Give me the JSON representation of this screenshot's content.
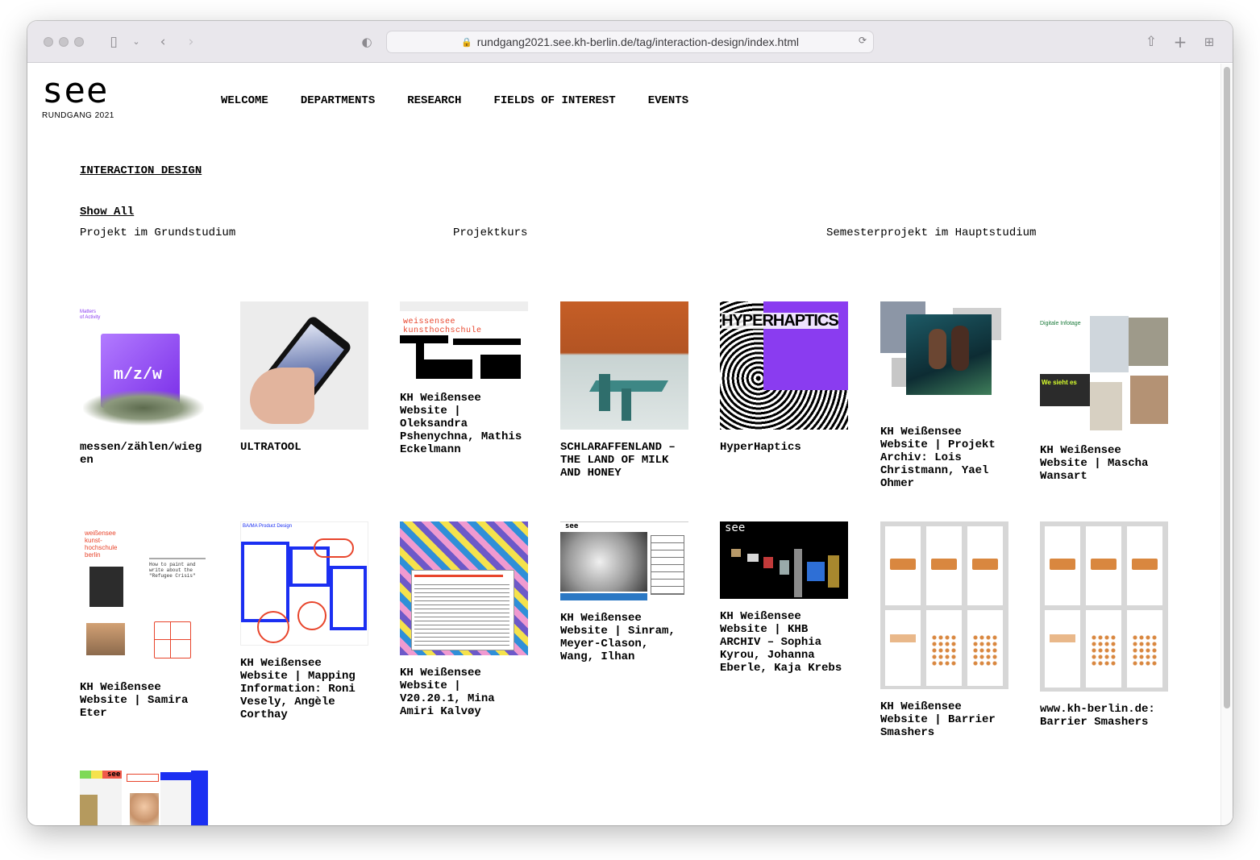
{
  "browser": {
    "url": "rundgang2021.see.kh-berlin.de/tag/interaction-design/index.html"
  },
  "site": {
    "logo": "see",
    "logo_sub": "RUNDGANG 2021"
  },
  "nav": [
    "WELCOME",
    "DEPARTMENTS",
    "RESEARCH",
    "FIELDS OF INTEREST",
    "EVENTS"
  ],
  "tag_title": "INTERACTION DESIGN",
  "filters": {
    "show_all": "Show All",
    "items": [
      "Projekt im Grundstudium",
      "Projektkurs",
      "Semesterprojekt im Hauptstudium"
    ]
  },
  "projects": [
    {
      "title": "messen/zählen/wiegen",
      "thumb_text": "m/z/w"
    },
    {
      "title": "ULTRATOOL",
      "thumb_text": ""
    },
    {
      "title": "KH Weißensee Website | Oleksandra Pshenychna, Mathis Eckelmann",
      "thumb_text": "weissensee kunsthochschule"
    },
    {
      "title": "SCHLARAFFENLAND – THE LAND OF MILK AND HONEY",
      "thumb_text": ""
    },
    {
      "title": "HyperHaptics",
      "thumb_text": "HYPERHAPTICS"
    },
    {
      "title": "KH Weißensee Website | Projekt Archiv: Lois Christmann, Yael Ohmer",
      "thumb_text": ""
    },
    {
      "title": "KH Weißensee Website | Mascha Wansart",
      "thumb_text": "Digitale Infotage"
    },
    {
      "title": "KH Weißensee Website | Samira Eter",
      "thumb_text": "weißensee kunst-hochschule berlin"
    },
    {
      "title": "KH Weißensee Website | Mapping Information: Roni Vesely, Angèle Corthay",
      "thumb_text": "BA/MA Product Design"
    },
    {
      "title": "KH Weißensee Website | V20.20.1, Mina Amiri Kalvøy",
      "thumb_text": ""
    },
    {
      "title": "KH Weißensee Website | Sinram, Meyer-Clason, Wang, Ilhan",
      "thumb_text": "see"
    },
    {
      "title": "KH Weißensee Website | KHB ARCHIV – Sophia Kyrou, Johanna Eberle, Kaja Krebs",
      "thumb_text": "see"
    },
    {
      "title": "KH Weißensee Website | Barrier Smashers",
      "thumb_text": ""
    },
    {
      "title": "www.kh-berlin.de: Barrier Smashers",
      "thumb_text": ""
    },
    {
      "title": "",
      "thumb_text": "see"
    }
  ],
  "colors": {
    "accent_purple": "#8a3cf0",
    "accent_red": "#e8452c",
    "accent_blue": "#1b2ff2",
    "accent_orange": "#d9873f"
  }
}
